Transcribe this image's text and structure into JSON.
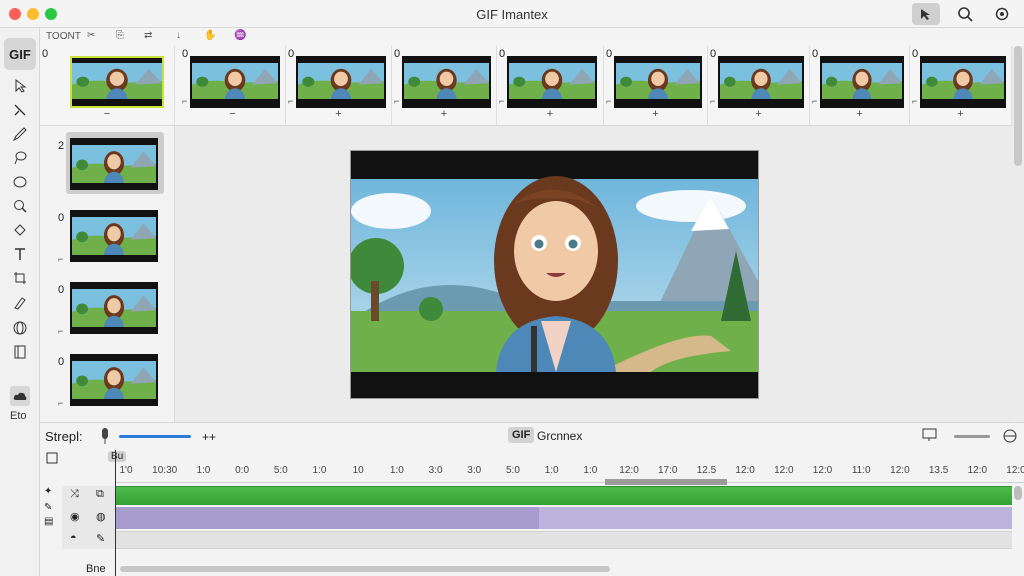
{
  "window": {
    "title": "GIF Imantex"
  },
  "toolbar_row": {
    "label": "TOONT"
  },
  "left_tools": {
    "gif_label": "GIF",
    "bottom_label": "Eto"
  },
  "filmstrip": {
    "frames": [
      {
        "num": "0",
        "mark": "",
        "sign": "−"
      },
      {
        "num": "0",
        "mark": "⌐",
        "sign": "−"
      },
      {
        "num": "0",
        "mark": "⌐",
        "sign": "+"
      },
      {
        "num": "0",
        "mark": "⌐",
        "sign": "+"
      },
      {
        "num": "0",
        "mark": "⌐",
        "sign": "+"
      },
      {
        "num": "0",
        "mark": "⌐",
        "sign": "+"
      },
      {
        "num": "0",
        "mark": "⌐",
        "sign": "+"
      },
      {
        "num": "0",
        "mark": "⌐",
        "sign": "+"
      },
      {
        "num": "0",
        "mark": "⌐",
        "sign": "+"
      }
    ]
  },
  "left_frames": [
    {
      "num": "2",
      "mark": ""
    },
    {
      "num": "0",
      "mark": "⌐"
    },
    {
      "num": "0",
      "mark": "⌐"
    },
    {
      "num": "0",
      "mark": "⌐"
    }
  ],
  "bottom": {
    "speed_label": "Strepl:",
    "plus_label": "++",
    "gif_badge": "GIF",
    "center_label": "Grcnnex",
    "playhead_label": "Bu",
    "track_footer": "Bne"
  },
  "ruler": [
    "1'0",
    "10:30",
    "1:0",
    "0:0",
    "5:0",
    "1:0",
    "10",
    "1:0",
    "3:0",
    "3:0",
    "5:0",
    "1:0",
    "1:0",
    "12:0",
    "17:0",
    "12.5",
    "12:0",
    "12:0",
    "12:0",
    "11:0",
    "12:0",
    "13.5",
    "12:0",
    "12:0"
  ],
  "colors": {
    "accent": "#2d7dd8",
    "track_green": "#3fae3f",
    "track_purple": "#bcb4dd"
  }
}
